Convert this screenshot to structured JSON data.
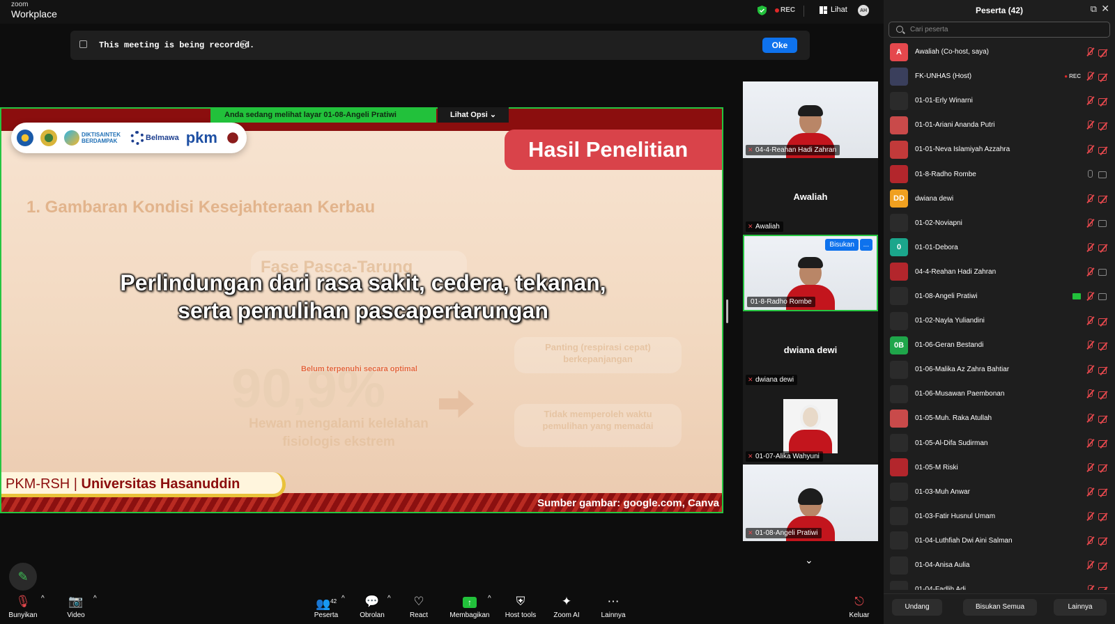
{
  "app": {
    "logo_top": "zoom",
    "logo_bottom": "Workplace"
  },
  "topbar": {
    "rec": "REC",
    "view_label": "Lihat",
    "avatar_initials": "AH"
  },
  "notice": {
    "message": "This meeting is being recorded.",
    "ok_label": "Oke"
  },
  "share": {
    "viewing_text": "Anda sedang melihat layar  01-08-Angeli Pratiwi",
    "options_label": "Lihat Opsi"
  },
  "slide": {
    "logo_texts": [
      "DIKTISAINTEK BERDAMPAK",
      "Belmawa",
      "pkm"
    ],
    "title": "Hasil Penelitian",
    "subheading": "1. Gambaran Kondisi Kesejahteraan Kerbau",
    "faded_phase": "Fase Pasca-Tarung",
    "faded_percent": "90,9%",
    "faded_small_note": "Belum terpenuhi secara optimal",
    "faded_animals": "Hewan mengalami kelelahan fisiologis ekstrem",
    "faded_box1": "Panting (respirasi cepat) berkepanjangan",
    "faded_box2": "Tidak memperoleh waktu pemulihan yang memadai",
    "caption_line1": "Perlindungan dari rasa sakit, cedera, tekanan,",
    "caption_line2": "serta pemulihan pascapertarungan",
    "footer_left_a": "PKM-RSH | ",
    "footer_left_b": "Universitas Hasanuddin",
    "footer_right": "Sumber gambar: google.com, Canva"
  },
  "gallery": [
    {
      "name": "04-4-Reahan Hadi Zahran",
      "type": "video"
    },
    {
      "name": "Awaliah",
      "center": "Awaliah",
      "type": "name"
    },
    {
      "name": "01-8-Radho Rombe",
      "type": "video",
      "selected": true,
      "badge": "Bisukan",
      "more": "..."
    },
    {
      "name": "dwiana dewi",
      "center": "dwiana dewi",
      "type": "name"
    },
    {
      "name": "01-07-Alika Wahyuni",
      "type": "photo"
    },
    {
      "name": "01-08-Angeli Pratiwi",
      "type": "video"
    }
  ],
  "participants": {
    "title": "Peserta (42)",
    "search_placeholder": "Cari peserta",
    "list": [
      {
        "name": "Awaliah (Co-host, saya)",
        "av": "A",
        "color": "#e5484d",
        "mic": "off",
        "cam": "off"
      },
      {
        "name": "FK-UNHAS (Host)",
        "av": "",
        "color": "#3a3f5c",
        "mic": "off",
        "cam": "off",
        "rec": "REC"
      },
      {
        "name": "01-01-Erly Winarni",
        "av": "",
        "color": "#2b2b2b",
        "mic": "off",
        "cam": "off"
      },
      {
        "name": "01-01-Ariani Ananda Putri",
        "av": "",
        "color": "#c94a4a",
        "mic": "off",
        "cam": "off"
      },
      {
        "name": "01-01-Neva Islamiyah Azzahra",
        "av": "",
        "color": "#c23a3a",
        "mic": "off",
        "cam": "off"
      },
      {
        "name": "01-8-Radho Rombe",
        "av": "",
        "color": "#b3262c",
        "mic": "on",
        "cam": "on"
      },
      {
        "name": "dwiana dewi",
        "av": "DD",
        "color": "#f0a020",
        "mic": "off",
        "cam": "off"
      },
      {
        "name": "01-02-Noviapni",
        "av": "",
        "color": "#2b2b2b",
        "mic": "off",
        "cam": "on"
      },
      {
        "name": "01-01-Debora",
        "av": "0",
        "color": "#1ba68c",
        "mic": "off",
        "cam": "off"
      },
      {
        "name": "04-4-Reahan Hadi Zahran",
        "av": "",
        "color": "#b3262c",
        "mic": "off",
        "cam": "on"
      },
      {
        "name": "01-08-Angeli Pratiwi",
        "av": "",
        "color": "#2b2b2b",
        "mic": "off",
        "cam": "on",
        "share": true
      },
      {
        "name": "01-02-Nayla Yuliandini",
        "av": "",
        "color": "#2b2b2b",
        "mic": "off",
        "cam": "off"
      },
      {
        "name": "01-06-Geran Bestandi",
        "av": "0B",
        "color": "#1fa64a",
        "mic": "off",
        "cam": "off"
      },
      {
        "name": "01-06-Malika Az Zahra Bahtiar",
        "av": "",
        "color": "#2b2b2b",
        "mic": "off",
        "cam": "off"
      },
      {
        "name": "01-06-Musawan Paembonan",
        "av": "",
        "color": "#2b2b2b",
        "mic": "off",
        "cam": "off"
      },
      {
        "name": "01-05-Muh. Raka Atullah",
        "av": "",
        "color": "#c94a4a",
        "mic": "off",
        "cam": "off"
      },
      {
        "name": "01-05-Al-Difa Sudirman",
        "av": "",
        "color": "#2b2b2b",
        "mic": "off",
        "cam": "off"
      },
      {
        "name": "01-05-M Riski",
        "av": "",
        "color": "#b3262c",
        "mic": "off",
        "cam": "off"
      },
      {
        "name": "01-03-Muh Anwar",
        "av": "",
        "color": "#2b2b2b",
        "mic": "off",
        "cam": "off"
      },
      {
        "name": "01-03-Fatir Husnul Umam",
        "av": "",
        "color": "#2b2b2b",
        "mic": "off",
        "cam": "off"
      },
      {
        "name": "01-04-Luthfiah Dwi Aini Salman",
        "av": "",
        "color": "#2b2b2b",
        "mic": "off",
        "cam": "off"
      },
      {
        "name": "01-04-Anisa Aulia",
        "av": "",
        "color": "#2b2b2b",
        "mic": "off",
        "cam": "off"
      },
      {
        "name": "01-04-Fadlih Adi",
        "av": "",
        "color": "#2b2b2b",
        "mic": "off",
        "cam": "off"
      }
    ],
    "bottom": {
      "mute_label": "Undang",
      "mute_all_label": "Bisukan Semua",
      "more_label": "Lainnya"
    }
  },
  "toolbar": {
    "audio": "Bunyikan",
    "video": "Video",
    "participants": "Peserta",
    "participants_count": "42",
    "chat": "Obrolan",
    "react": "React",
    "share": "Membagikan",
    "host_tools": "Host tools",
    "ai": "Zoom AI",
    "more": "Lainnya",
    "leave": "Keluar"
  },
  "colors": {
    "accent": "#0e72ed",
    "share_green": "#22c13b",
    "muted_red": "#e5484d",
    "slide_red": "#8b0e0e"
  }
}
